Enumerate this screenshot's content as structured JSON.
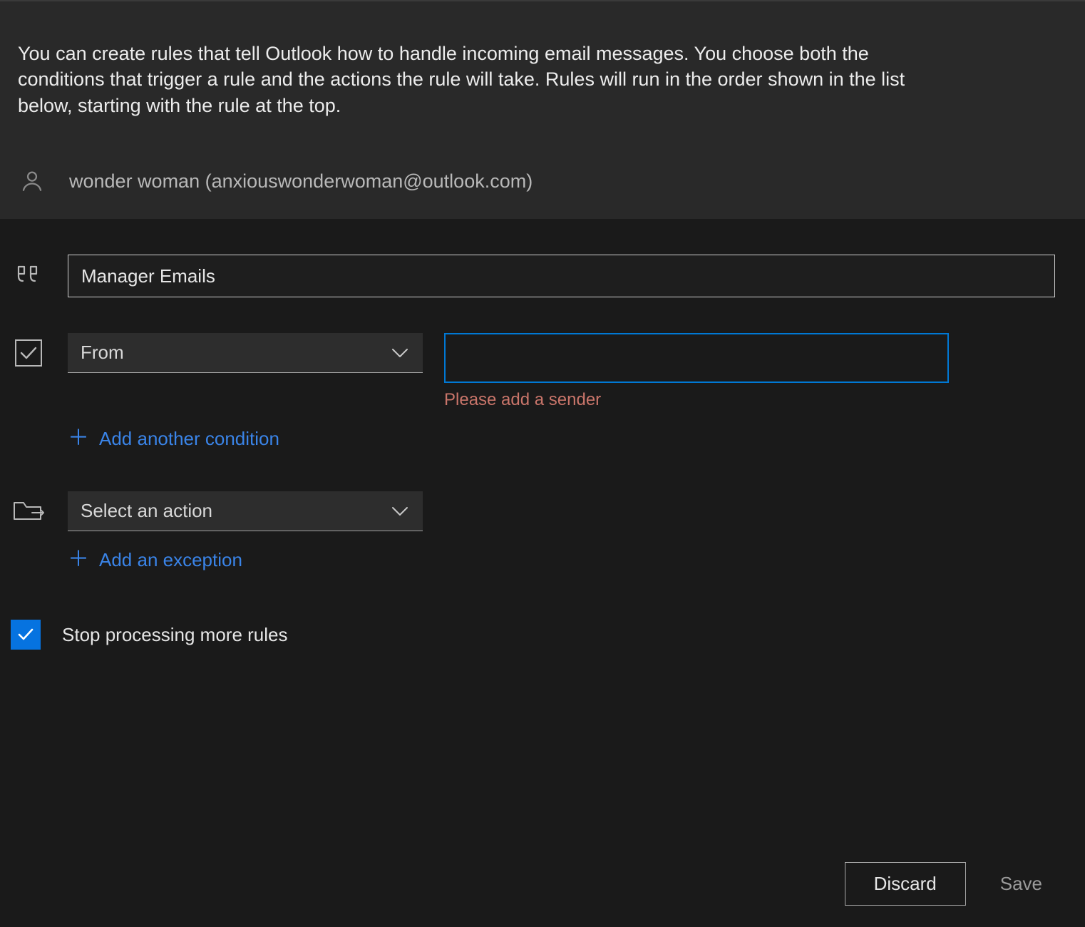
{
  "header": {
    "description": "You can create rules that tell Outlook how to handle incoming email messages. You choose both the conditions that trigger a rule and the actions the rule will take. Rules will run in the order shown in the list below, starting with the rule at the top.",
    "account_label": "wonder woman (anxiouswonderwoman@outlook.com)"
  },
  "rule": {
    "name_value": "Manager Emails"
  },
  "condition": {
    "select_value": "From",
    "sender_value": "",
    "error": "Please add a sender",
    "add_link": "Add another condition"
  },
  "action": {
    "select_value": "Select an action",
    "exception_link": "Add an exception"
  },
  "stop_processing": {
    "label": "Stop processing more rules",
    "checked": true
  },
  "footer": {
    "discard": "Discard",
    "save": "Save"
  }
}
